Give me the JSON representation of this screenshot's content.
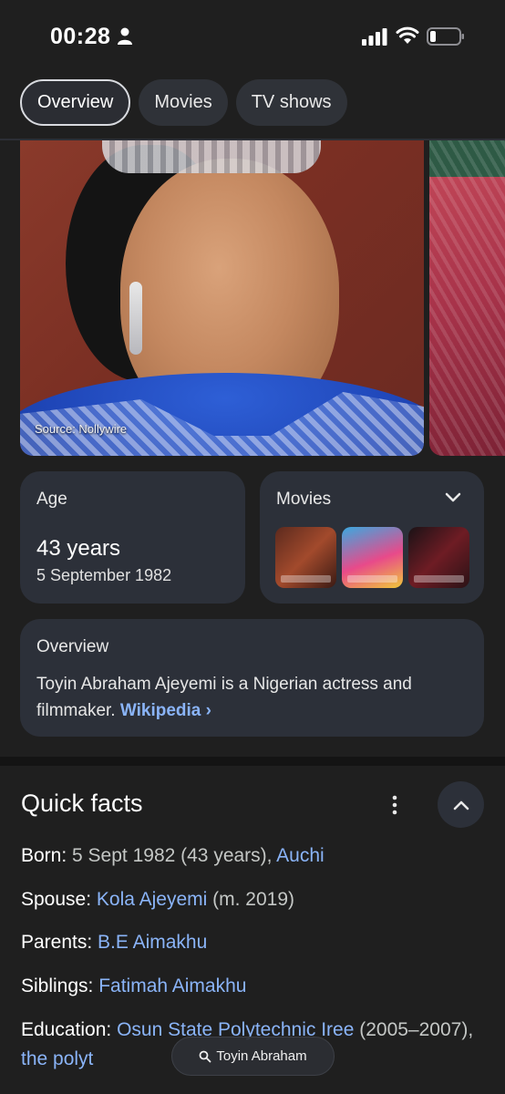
{
  "status_bar": {
    "time": "00:28"
  },
  "tabs": [
    {
      "label": "Overview"
    },
    {
      "label": "Movies"
    },
    {
      "label": "TV shows"
    }
  ],
  "hero_image": {
    "source": "Source: Nollywire"
  },
  "age_card": {
    "label": "Age",
    "value": "43 years",
    "date": "5 September 1982"
  },
  "movies_card": {
    "label": "Movies"
  },
  "overview_card": {
    "label": "Overview",
    "text": "Toyin Abraham Ajeyemi is a Nigerian actress and filmmaker. ",
    "link": "Wikipedia ›"
  },
  "quick_facts": {
    "title": "Quick facts",
    "born": {
      "key": "Born",
      "value": "5 Sept 1982 (43 years), ",
      "link": "Auchi"
    },
    "spouse": {
      "key": "Spouse",
      "link": "Kola Ajeyemi",
      "value": " (m. 2019)"
    },
    "parents": {
      "key": "Parents",
      "link": "B.E Aimakhu"
    },
    "siblings": {
      "key": "Siblings",
      "link": "Fatimah Aimakhu"
    },
    "education": {
      "key": "Education",
      "link": "Osun State Polytechnic Iree",
      "value": " (2005–2007), ",
      "link2": "the polyt"
    }
  },
  "bottom_search": {
    "label": "Toyin Abraham"
  },
  "colors": {
    "background": "#1f1f1f",
    "card": "#2c3039",
    "link": "#8ab4f8"
  }
}
